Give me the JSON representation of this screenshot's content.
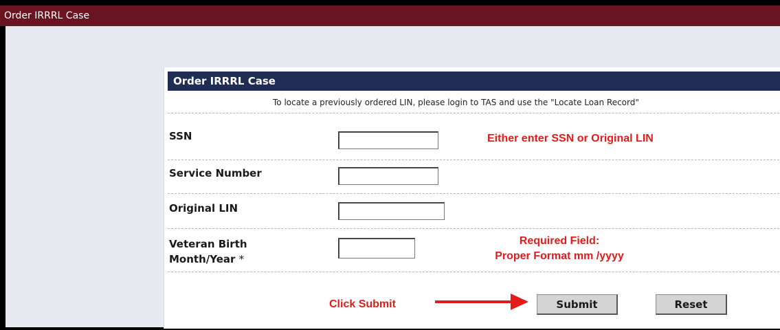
{
  "window": {
    "title": "Order IRRRL Case"
  },
  "form": {
    "header": "Order IRRRL Case",
    "notice": "To locate a previously ordered LIN, please login to TAS and use the \"Locate Loan Record\"",
    "fields": {
      "ssn": {
        "label": "SSN",
        "value": ""
      },
      "service_number": {
        "label": "Service Number",
        "value": ""
      },
      "original_lin": {
        "label": "Original LIN",
        "value": ""
      },
      "veteran_birth": {
        "label_line1": "Veteran Birth",
        "label_line2": "Month/Year",
        "required_marker": "*",
        "value": ""
      }
    },
    "buttons": {
      "submit": "Submit",
      "reset": "Reset"
    }
  },
  "annotations": {
    "ssn_hint": "Either enter SSN or Original LIN",
    "birth_hint_line1": "Required Field:",
    "birth_hint_line2": "Proper Format mm /yyyy",
    "submit_hint": "Click Submit",
    "color": "#e21b1b"
  }
}
